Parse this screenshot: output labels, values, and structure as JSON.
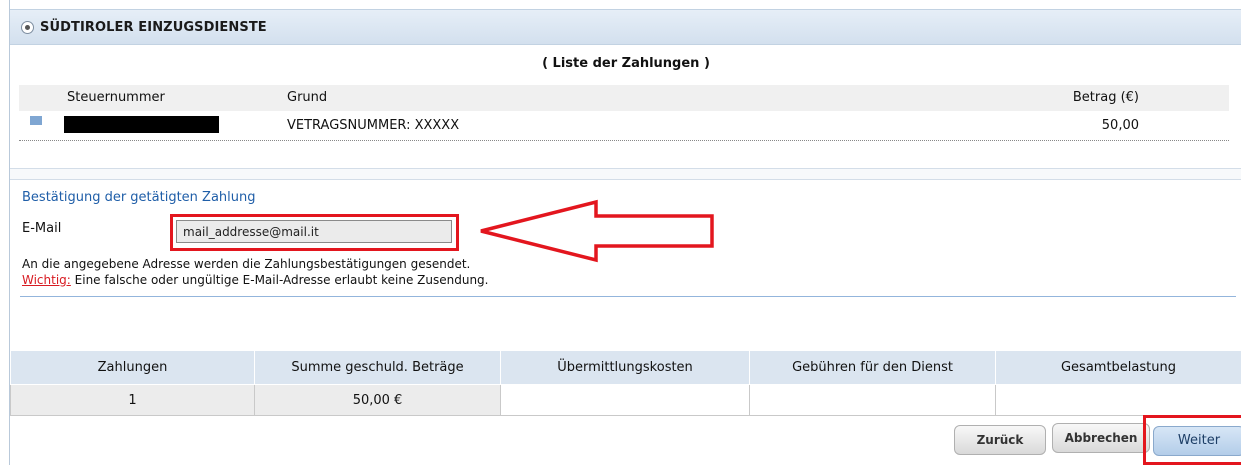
{
  "header": {
    "title": "SÜDTIROLER EINZUGSDIENSTE"
  },
  "payments": {
    "title": "( Liste der Zahlungen )",
    "columns": [
      "Steuernummer",
      "Grund",
      "Betrag (€)"
    ],
    "rows": [
      {
        "steuernummer": "",
        "grund": "VETRAGSNUMMER: XXXXX",
        "betrag": "50,00"
      }
    ]
  },
  "confirmation": {
    "title": "Bestätigung der getätigten Zahlung",
    "email_label": "E-Mail",
    "email_value": "mail_addresse@mail.it",
    "info": "An die angegebene Adresse werden die Zahlungsbestätigungen gesendet.",
    "warning_label": "Wichtig:",
    "warning_text": " Eine falsche oder ungültige E-Mail-Adresse erlaubt keine Zusendung."
  },
  "summary": {
    "columns": [
      "Zahlungen",
      "Summe geschuld. Beträge",
      "Übermittlungskosten",
      "Gebühren für den Dienst",
      "Gesamtbelastung"
    ],
    "values": [
      "1",
      "50,00 €",
      "",
      "",
      ""
    ]
  },
  "buttons": {
    "back": "Zurück",
    "cancel": "Abbrechen",
    "next": "Weiter"
  },
  "colors": {
    "annotation": "#e3161e",
    "accent": "#1f5ea8"
  }
}
